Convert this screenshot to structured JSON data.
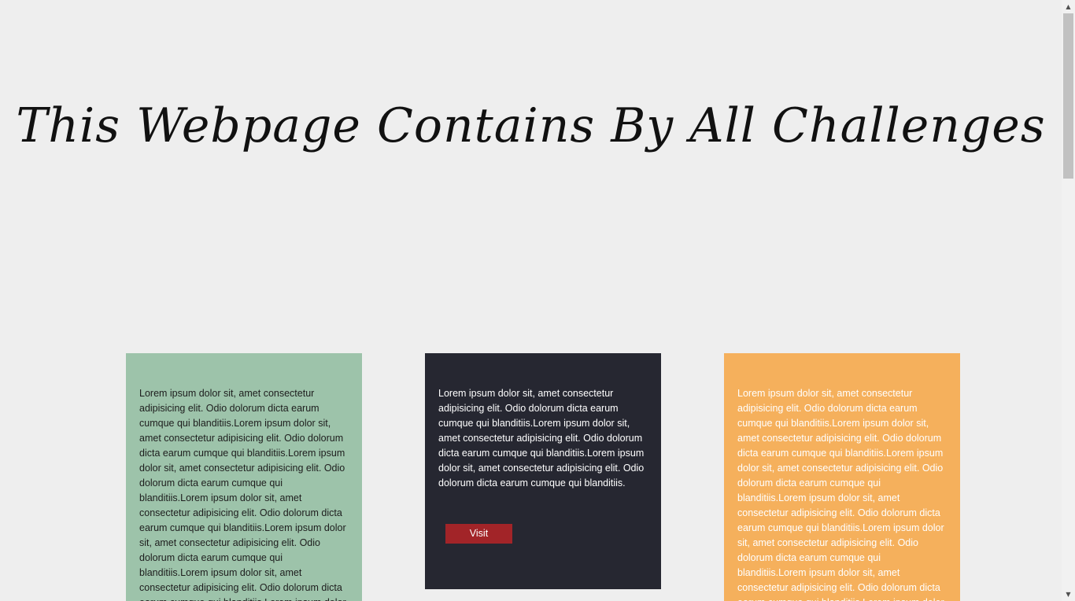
{
  "page": {
    "heading": "This Webpage Contains By All Challenges"
  },
  "cards": [
    {
      "text": "Lorem ipsum dolor sit, amet consectetur adipisicing elit. Odio dolorum dicta earum cumque qui blanditiis.Lorem ipsum dolor sit, amet consectetur adipisicing elit. Odio dolorum dicta earum cumque qui blanditiis.Lorem ipsum dolor sit, amet consectetur adipisicing elit. Odio dolorum dicta earum cumque qui blanditiis.Lorem ipsum dolor sit, amet consectetur adipisicing elit. Odio dolorum dicta earum cumque qui blanditiis.Lorem ipsum dolor sit, amet consectetur adipisicing elit. Odio dolorum dicta earum cumque qui blanditiis.Lorem ipsum dolor sit, amet consectetur adipisicing elit. Odio dolorum dicta earum cumque qui blanditiis.Lorem ipsum dolor sit, amet consectetur adipisicing elit.",
      "color": "#9dc3aa"
    },
    {
      "text": "Lorem ipsum dolor sit, amet consectetur adipisicing elit. Odio dolorum dicta earum cumque qui blanditiis.Lorem ipsum dolor sit, amet consectetur adipisicing elit. Odio dolorum dicta earum cumque qui blanditiis.Lorem ipsum dolor sit, amet consectetur adipisicing elit. Odio dolorum dicta earum cumque qui blanditiis.",
      "button_label": "Visit",
      "color": "#262731",
      "button_color": "#a22428"
    },
    {
      "text": "Lorem ipsum dolor sit, amet consectetur adipisicing elit. Odio dolorum dicta earum cumque qui blanditiis.Lorem ipsum dolor sit, amet consectetur adipisicing elit. Odio dolorum dicta earum cumque qui blanditiis.Lorem ipsum dolor sit, amet consectetur adipisicing elit. Odio dolorum dicta earum cumque qui blanditiis.Lorem ipsum dolor sit, amet consectetur adipisicing elit. Odio dolorum dicta earum cumque qui blanditiis.Lorem ipsum dolor sit, amet consectetur adipisicing elit. Odio dolorum dicta earum cumque qui blanditiis.Lorem ipsum dolor sit, amet consectetur adipisicing elit. Odio dolorum dicta earum cumque qui blanditiis.Lorem ipsum dolor sit, amet consectetur adipisicing elit.",
      "color": "#f5b05c"
    }
  ],
  "scrollbar": {
    "up_icon": "arrow-up-icon",
    "down_icon": "arrow-down-icon"
  }
}
